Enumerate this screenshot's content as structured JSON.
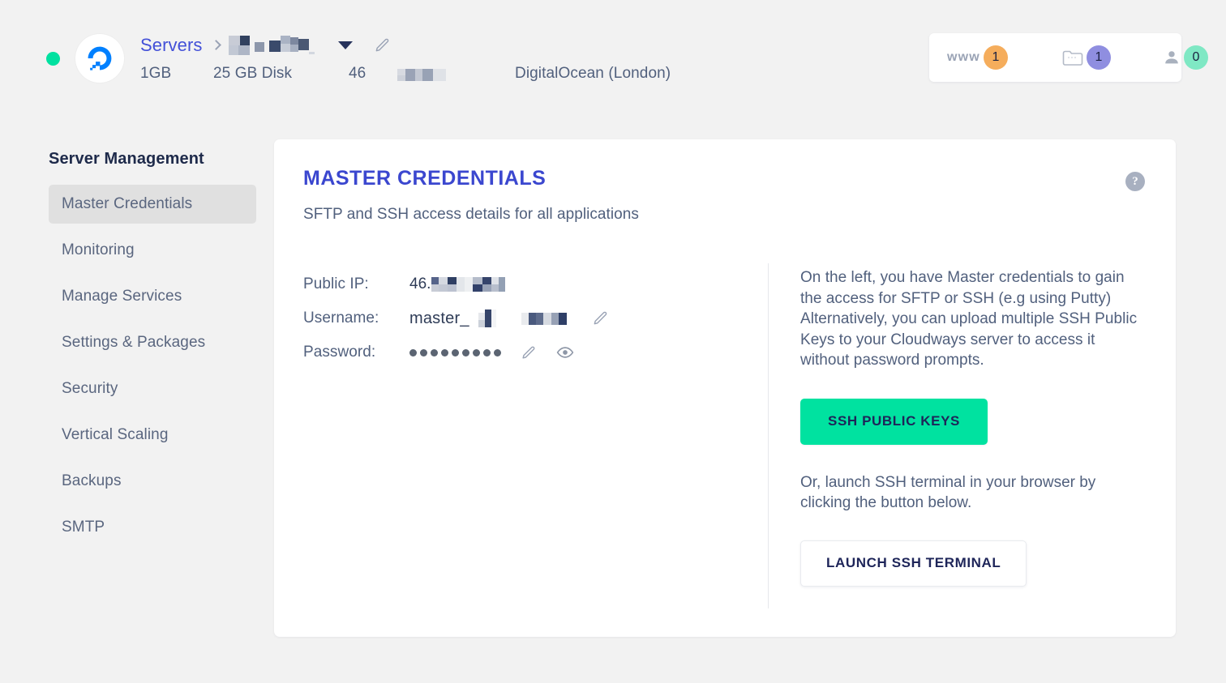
{
  "header": {
    "status": "online",
    "provider_logo": "digitalocean-logo",
    "breadcrumb_root": "Servers",
    "server_name": "[redacted]",
    "ram": "1GB",
    "disk": "25 GB Disk",
    "cores": "46",
    "ip_partial": "[redacted]",
    "provider": "DigitalOcean (London)",
    "counters": {
      "www_label": "www",
      "www_count": "1",
      "apps_icon": "folder-icon",
      "apps_count": "1",
      "users_icon": "person-icon",
      "users_count": "0"
    }
  },
  "sidebar": {
    "title": "Server Management",
    "items": [
      {
        "label": "Master Credentials",
        "active": true
      },
      {
        "label": "Monitoring",
        "active": false
      },
      {
        "label": "Manage Services",
        "active": false
      },
      {
        "label": "Settings & Packages",
        "active": false
      },
      {
        "label": "Security",
        "active": false
      },
      {
        "label": "Vertical Scaling",
        "active": false
      },
      {
        "label": "Backups",
        "active": false
      },
      {
        "label": "SMTP",
        "active": false
      }
    ]
  },
  "card": {
    "title": "MASTER CREDENTIALS",
    "subtitle": "SFTP and SSH access details for all applications",
    "help_icon": "question-mark-icon",
    "credentials": {
      "public_ip_label": "Public IP:",
      "public_ip_value": "46.",
      "username_label": "Username:",
      "username_value": "master_",
      "password_label": "Password:",
      "password_masked": "●●●●●●●●●",
      "edit_icon": "pencil-icon",
      "reveal_icon": "eye-icon"
    },
    "info": {
      "paragraph": "On the left, you have Master credentials to gain the access for SFTP or SSH (e.g using Putty) Alternatively, you can upload multiple SSH Public Keys to your Cloudways server to access it without password prompts.",
      "ssh_keys_button": "SSH PUBLIC KEYS",
      "terminal_hint": "Or, launch SSH terminal in your browser by clicking the button below.",
      "launch_terminal_button": "LAUNCH SSH TERMINAL"
    }
  },
  "colors": {
    "accent_indigo": "#3b47cf",
    "accent_green": "#00e2a0",
    "status_green": "#00e1a0",
    "badge_orange": "#f5ad5c",
    "badge_purple": "#8f8ee0",
    "badge_green": "#7fe8c4",
    "page_bg": "#f2f2f2",
    "text_muted": "#51607d"
  }
}
